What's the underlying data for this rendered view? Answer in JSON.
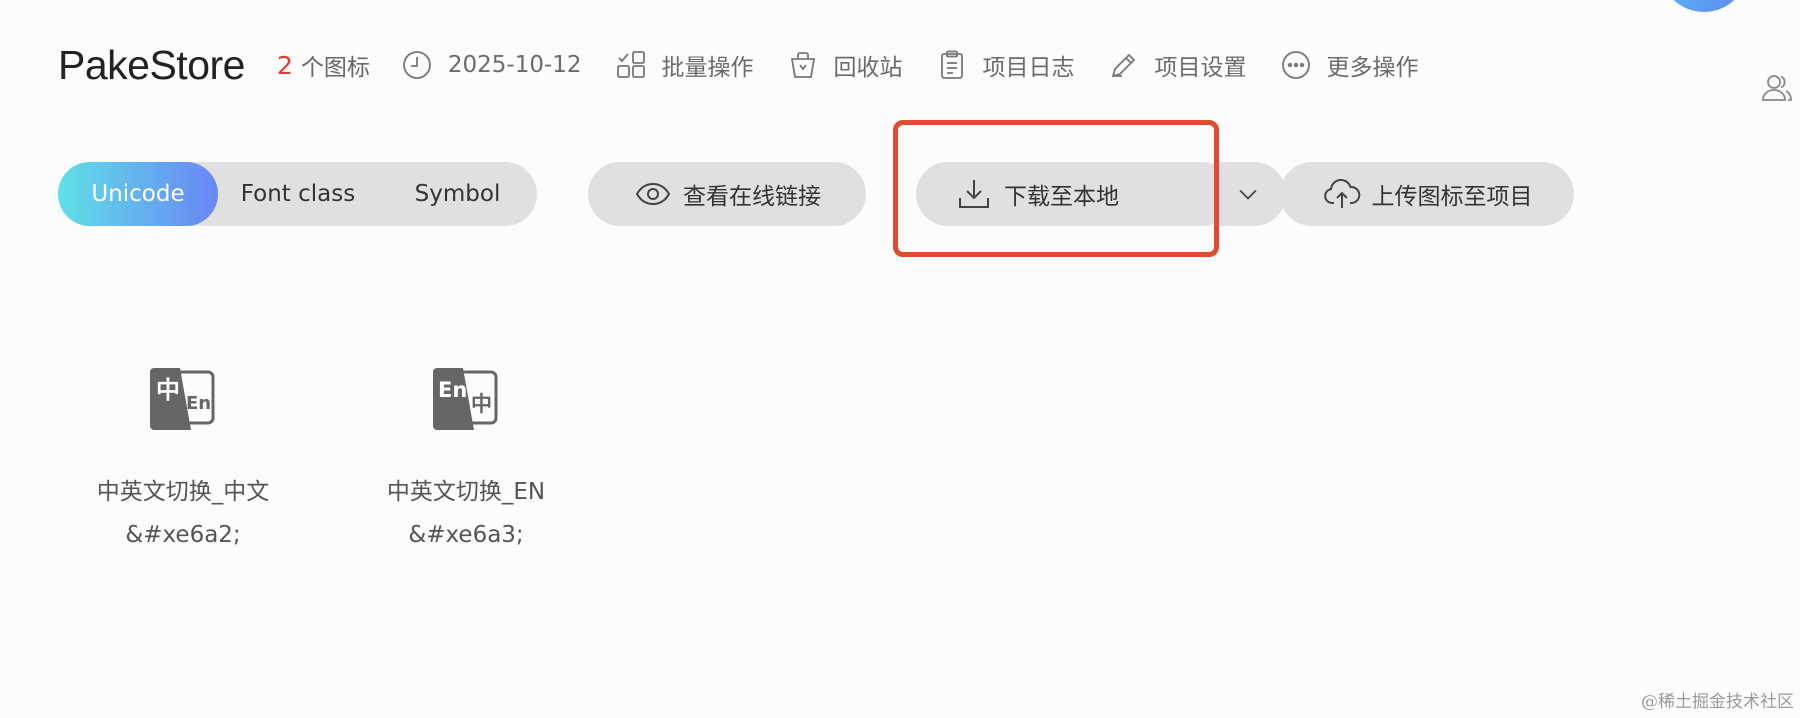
{
  "header": {
    "project_title": "PakeStore",
    "icon_count": "2",
    "icon_count_label": "个图标",
    "date": "2025-10-12",
    "batch_ops": "批量操作",
    "recycle_bin": "回收站",
    "project_log": "项目日志",
    "project_settings": "项目设置",
    "more_ops": "更多操作"
  },
  "toolbar": {
    "tabs": [
      {
        "label": "Unicode",
        "active": true
      },
      {
        "label": "Font class",
        "active": false
      },
      {
        "label": "Symbol",
        "active": false
      }
    ],
    "view_online_link": "查看在线链接",
    "download_local": "下载至本地",
    "upload_icons": "上传图标至项目"
  },
  "icons": [
    {
      "name": "中英文切换_中文",
      "code": "&#xe6a2;",
      "glyph": "zh-en-switch-icon"
    },
    {
      "name": "中英文切换_EN",
      "code": "&#xe6a3;",
      "glyph": "en-zh-switch-icon"
    }
  ],
  "glyph_text": {
    "zh": "中",
    "en": "En"
  },
  "watermark": "@稀土掘金技术社区",
  "colors": {
    "accent_red": "#e33a2f",
    "highlight_border": "#e04a2f",
    "tab_gradient_start": "#60e0e6",
    "tab_gradient_end": "#6a85f5",
    "pill_bg": "#e0e0e0"
  }
}
